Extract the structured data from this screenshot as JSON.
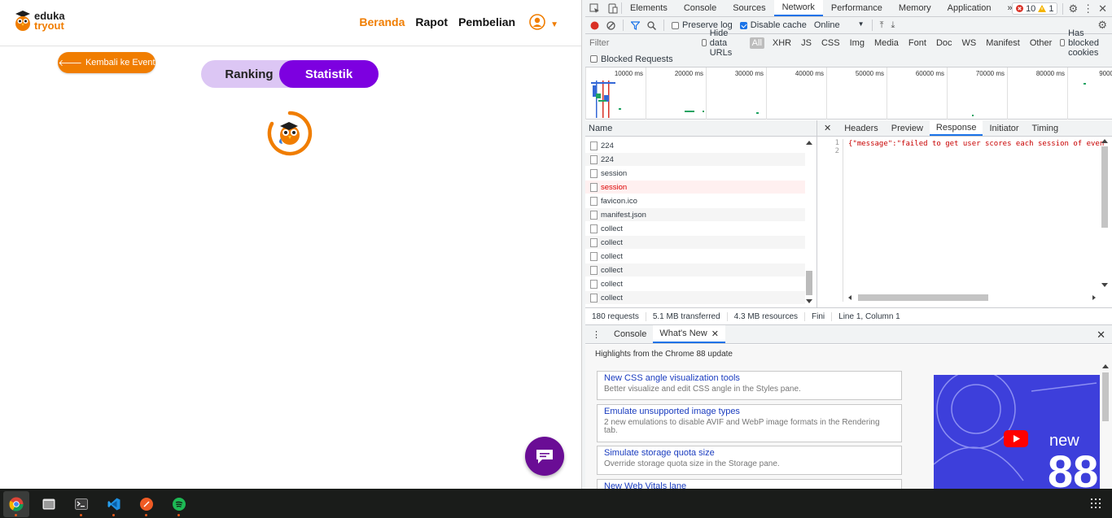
{
  "website": {
    "logo": {
      "line1": "eduka",
      "line2": "tryout"
    },
    "nav": {
      "items": [
        "Beranda",
        "Rapot",
        "Pembelian"
      ],
      "active_index": 0
    },
    "back_button_label": "Kembali ke Event",
    "toggle": {
      "ranking_label": "Ranking",
      "statistik_label": "Statistik",
      "active": "Statistik"
    },
    "colors": {
      "brand_orange": "#f07d00",
      "brand_purple": "#7d00e0",
      "chat_purple": "#6a0d95"
    }
  },
  "devtools": {
    "tabs": [
      "Elements",
      "Console",
      "Sources",
      "Network",
      "Performance",
      "Memory",
      "Application"
    ],
    "active_tab": "Network",
    "more_tabs_icon": "double-chevron-right",
    "issues": {
      "errors": "10",
      "warnings": "1"
    },
    "toolbar": {
      "preserve_log_label": "Preserve log",
      "preserve_log_checked": false,
      "disable_cache_label": "Disable cache",
      "disable_cache_checked": true,
      "throttle_value": "Online"
    },
    "filter": {
      "placeholder": "Filter",
      "hide_data_urls_label": "Hide data URLs",
      "types": [
        "All",
        "XHR",
        "JS",
        "CSS",
        "Img",
        "Media",
        "Font",
        "Doc",
        "WS",
        "Manifest",
        "Other"
      ],
      "active_type": "All",
      "has_blocked_cookies_label": "Has blocked cookies",
      "blocked_requests_label": "Blocked Requests"
    },
    "overview_ticks": [
      "10000 ms",
      "20000 ms",
      "30000 ms",
      "40000 ms",
      "50000 ms",
      "60000 ms",
      "70000 ms",
      "80000 ms",
      "9000"
    ],
    "request_list": {
      "column_name": "Name",
      "rows": [
        {
          "name": "224",
          "error": false
        },
        {
          "name": "224",
          "error": false
        },
        {
          "name": "session",
          "error": false
        },
        {
          "name": "session",
          "error": true
        },
        {
          "name": "favicon.ico",
          "error": false
        },
        {
          "name": "manifest.json",
          "error": false
        },
        {
          "name": "collect",
          "error": false
        },
        {
          "name": "collect",
          "error": false
        },
        {
          "name": "collect",
          "error": false
        },
        {
          "name": "collect",
          "error": false
        },
        {
          "name": "collect",
          "error": false
        },
        {
          "name": "collect",
          "error": false
        }
      ]
    },
    "response_panel": {
      "tabs": [
        "Headers",
        "Preview",
        "Response",
        "Initiator",
        "Timing"
      ],
      "active_tab": "Response",
      "line_numbers": [
        "1",
        "2"
      ],
      "code": "{\"message\":\"failed to get user scores each session of even"
    },
    "status": {
      "requests": "180 requests",
      "transferred": "5.1 MB transferred",
      "resources": "4.3 MB resources",
      "finish": "Fini",
      "cursor_position": "Line 1, Column 1"
    },
    "drawer": {
      "tabs": [
        "Console",
        "What's New"
      ],
      "active_tab": "What's New",
      "highlights_title": "Highlights from the Chrome 88 update",
      "cards": [
        {
          "title": "New CSS angle visualization tools",
          "desc": "Better visualize and edit CSS angle in the Styles pane."
        },
        {
          "title": "Emulate unsupported image types",
          "desc": "2 new emulations to disable AVIF and WebP image formats in the Rendering tab."
        },
        {
          "title": "Simulate storage quota size",
          "desc": "Override storage quota size in the Storage pane."
        },
        {
          "title": "New Web Vitals lane",
          "desc": ""
        }
      ],
      "video": {
        "label_new": "new",
        "label_version": "88"
      }
    }
  },
  "taskbar": {
    "apps": [
      "chrome",
      "files",
      "terminal",
      "vscode",
      "postman",
      "spotify"
    ],
    "active_app": "chrome"
  }
}
